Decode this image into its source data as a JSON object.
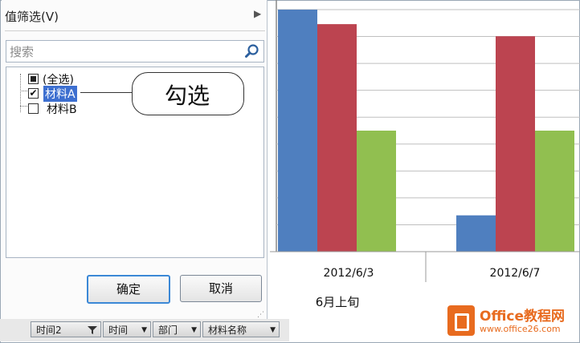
{
  "filter_menu": {
    "value_filter_label": "值筛选(V)",
    "search_placeholder": "搜索",
    "tree_items": [
      {
        "label": "(全选)",
        "state": "mixed"
      },
      {
        "label": "材料A",
        "state": "checked",
        "selected": true
      },
      {
        "label": "材料B",
        "state": "unchecked"
      }
    ],
    "ok_label": "确定",
    "cancel_label": "取消"
  },
  "callout": {
    "text": "勾选"
  },
  "field_buttons": [
    {
      "label": "时间2",
      "filtered": true
    },
    {
      "label": "时间"
    },
    {
      "label": "部门"
    },
    {
      "label": "材料名称"
    }
  ],
  "chart_data": {
    "type": "bar",
    "categories": [
      "2012/6/3",
      "2012/6/7"
    ],
    "group_label": "6月上旬",
    "series": [
      {
        "color": "#4f7fbf",
        "values": [
          100,
          15
        ]
      },
      {
        "color": "#bc4450",
        "values": [
          94,
          89
        ]
      },
      {
        "color": "#91bf50",
        "values": [
          50,
          50
        ]
      }
    ],
    "ylim": [
      0,
      100
    ],
    "grid": true
  },
  "watermark": {
    "title": "Office教程网",
    "url": "www.office26.com"
  }
}
